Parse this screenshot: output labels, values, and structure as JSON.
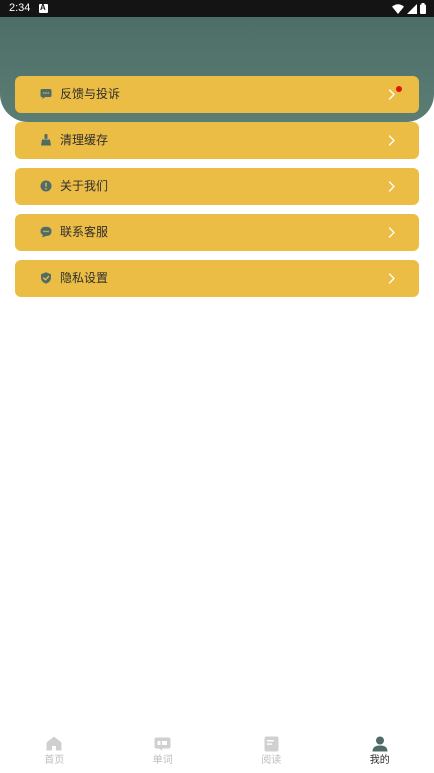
{
  "status_bar": {
    "time": "2:34",
    "icons": [
      "notification-a-icon",
      "wifi-icon",
      "signal-icon",
      "battery-icon"
    ]
  },
  "menu": {
    "items": [
      {
        "label": "反馈与投诉",
        "icon": "message-icon",
        "has_badge": true
      },
      {
        "label": "清理缓存",
        "icon": "broom-icon",
        "has_badge": false
      },
      {
        "label": "关于我们",
        "icon": "info-icon",
        "has_badge": false
      },
      {
        "label": "联系客服",
        "icon": "chat-icon",
        "has_badge": false
      },
      {
        "label": "隐私设置",
        "icon": "shield-icon",
        "has_badge": false
      }
    ]
  },
  "bottom_nav": {
    "items": [
      {
        "label": "首页",
        "icon": "home-icon",
        "active": false
      },
      {
        "label": "单词",
        "icon": "word-card-icon",
        "active": false
      },
      {
        "label": "阅读",
        "icon": "document-icon",
        "active": false
      },
      {
        "label": "我的",
        "icon": "user-icon",
        "active": true
      }
    ]
  },
  "colors": {
    "header": "#557770",
    "menu_item": "#ebbd45",
    "icon": "#4f6c66",
    "chevron": "#ffffff",
    "badge": "#e3120b",
    "nav_inactive": "#d0d0d0",
    "nav_active": "#4f6c66"
  }
}
